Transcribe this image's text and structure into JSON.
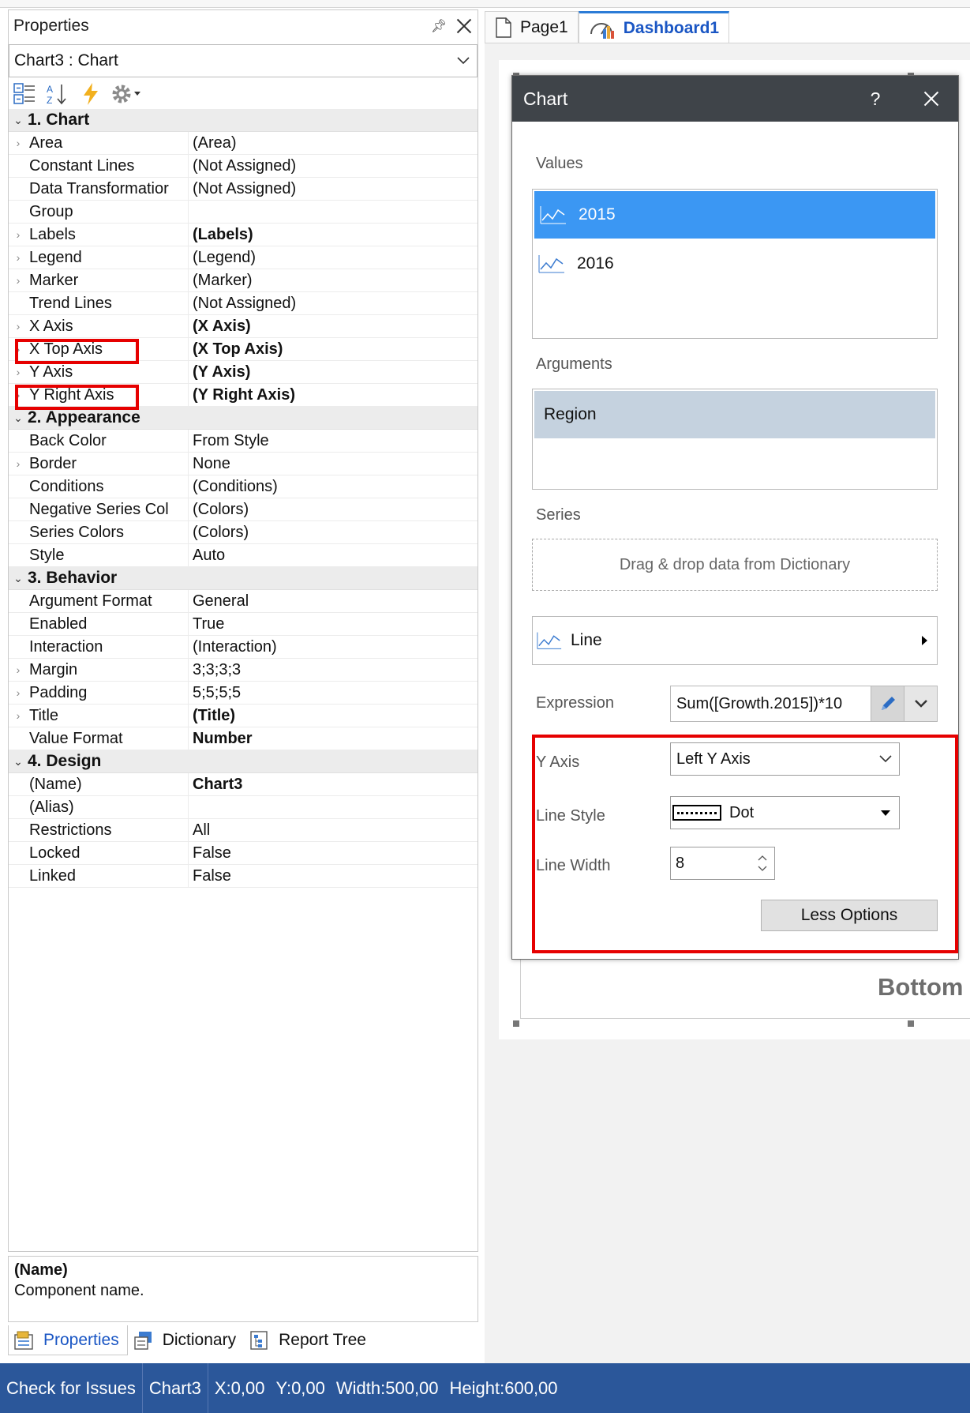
{
  "properties_panel": {
    "title": "Properties",
    "component_selector": "Chart3 : Chart",
    "categories": [
      {
        "label": "1. Chart",
        "rows": [
          {
            "name": "Area",
            "value": "(Area)",
            "expandable": true,
            "bold": false
          },
          {
            "name": "Constant Lines",
            "value": "(Not Assigned)",
            "expandable": false,
            "bold": false
          },
          {
            "name": "Data Transformatior",
            "value": "(Not Assigned)",
            "expandable": false,
            "bold": false
          },
          {
            "name": "Group",
            "value": "",
            "expandable": false,
            "bold": false
          },
          {
            "name": "Labels",
            "value": "(Labels)",
            "expandable": true,
            "bold": true
          },
          {
            "name": "Legend",
            "value": "(Legend)",
            "expandable": true,
            "bold": false
          },
          {
            "name": "Marker",
            "value": "(Marker)",
            "expandable": true,
            "bold": false
          },
          {
            "name": "Trend Lines",
            "value": "(Not Assigned)",
            "expandable": false,
            "bold": false
          },
          {
            "name": "X Axis",
            "value": "(X Axis)",
            "expandable": true,
            "bold": true
          },
          {
            "name": "X Top Axis",
            "value": "(X Top Axis)",
            "expandable": true,
            "bold": true
          },
          {
            "name": "Y Axis",
            "value": "(Y Axis)",
            "expandable": true,
            "bold": true
          },
          {
            "name": "Y Right Axis",
            "value": "(Y Right Axis)",
            "expandable": true,
            "bold": true
          }
        ]
      },
      {
        "label": "2. Appearance",
        "rows": [
          {
            "name": "Back Color",
            "value": "From Style",
            "expandable": false,
            "bold": false
          },
          {
            "name": "Border",
            "value": "None",
            "expandable": true,
            "bold": false
          },
          {
            "name": "Conditions",
            "value": "(Conditions)",
            "expandable": false,
            "bold": false
          },
          {
            "name": "Negative Series Col",
            "value": "(Colors)",
            "expandable": false,
            "bold": false
          },
          {
            "name": "Series Colors",
            "value": "(Colors)",
            "expandable": false,
            "bold": false
          },
          {
            "name": "Style",
            "value": "Auto",
            "expandable": false,
            "bold": false
          }
        ]
      },
      {
        "label": "3. Behavior",
        "rows": [
          {
            "name": "Argument Format",
            "value": "General",
            "expandable": false,
            "bold": false
          },
          {
            "name": "Enabled",
            "value": "True",
            "expandable": false,
            "bold": false
          },
          {
            "name": "Interaction",
            "value": "(Interaction)",
            "expandable": false,
            "bold": false
          },
          {
            "name": "Margin",
            "value": "3;3;3;3",
            "expandable": true,
            "bold": false
          },
          {
            "name": "Padding",
            "value": "5;5;5;5",
            "expandable": true,
            "bold": false
          },
          {
            "name": "Title",
            "value": "(Title)",
            "expandable": true,
            "bold": true
          },
          {
            "name": "Value Format",
            "value": "Number",
            "expandable": false,
            "bold": true
          }
        ]
      },
      {
        "label": "4. Design",
        "rows": [
          {
            "name": "(Name)",
            "value": "Chart3",
            "expandable": false,
            "bold": true
          },
          {
            "name": "(Alias)",
            "value": "",
            "expandable": false,
            "bold": false
          },
          {
            "name": "Restrictions",
            "value": "All",
            "expandable": false,
            "bold": false
          },
          {
            "name": "Locked",
            "value": "False",
            "expandable": false,
            "bold": false
          },
          {
            "name": "Linked",
            "value": "False",
            "expandable": false,
            "bold": false
          }
        ]
      }
    ],
    "description": {
      "name": "(Name)",
      "text": "Component name."
    }
  },
  "bottom_tabs": [
    {
      "label": "Properties",
      "icon": "properties-icon",
      "active": true
    },
    {
      "label": "Dictionary",
      "icon": "dictionary-icon",
      "active": false
    },
    {
      "label": "Report Tree",
      "icon": "report-tree-icon",
      "active": false
    }
  ],
  "doc_tabs": [
    {
      "label": "Page1",
      "icon": "page-icon",
      "active": false
    },
    {
      "label": "Dashboard1",
      "icon": "dashboard-icon",
      "active": true
    }
  ],
  "canvas": {
    "bottom_label": "Bottom"
  },
  "chart_dialog": {
    "title": "Chart",
    "help": "?",
    "values_label": "Values",
    "values": [
      {
        "label": "2015",
        "selected": true
      },
      {
        "label": "2016",
        "selected": false
      }
    ],
    "arguments_label": "Arguments",
    "arguments": [
      "Region"
    ],
    "series_label": "Series",
    "series_placeholder": "Drag & drop data from Dictionary",
    "series_type": "Line",
    "expression_label": "Expression",
    "expression_value": "Sum([Growth.2015])*10",
    "y_axis_label": "Y Axis",
    "y_axis_value": "Left Y Axis",
    "line_style_label": "Line Style",
    "line_style_value": "Dot",
    "line_width_label": "Line Width",
    "line_width_value": "8",
    "less_options": "Less Options"
  },
  "status_bar": {
    "check": "Check for Issues",
    "component": "Chart3",
    "x": "X:0,00",
    "y": "Y:0,00",
    "width": "Width:500,00",
    "height": "Height:600,00"
  },
  "colors": {
    "status_bar": "#2b579a",
    "selection": "#3b97f3",
    "argument_bg": "#c5d2df",
    "dialog_header": "#3f4449",
    "highlight": "#e60000",
    "active_tab": "#1a56c4"
  }
}
